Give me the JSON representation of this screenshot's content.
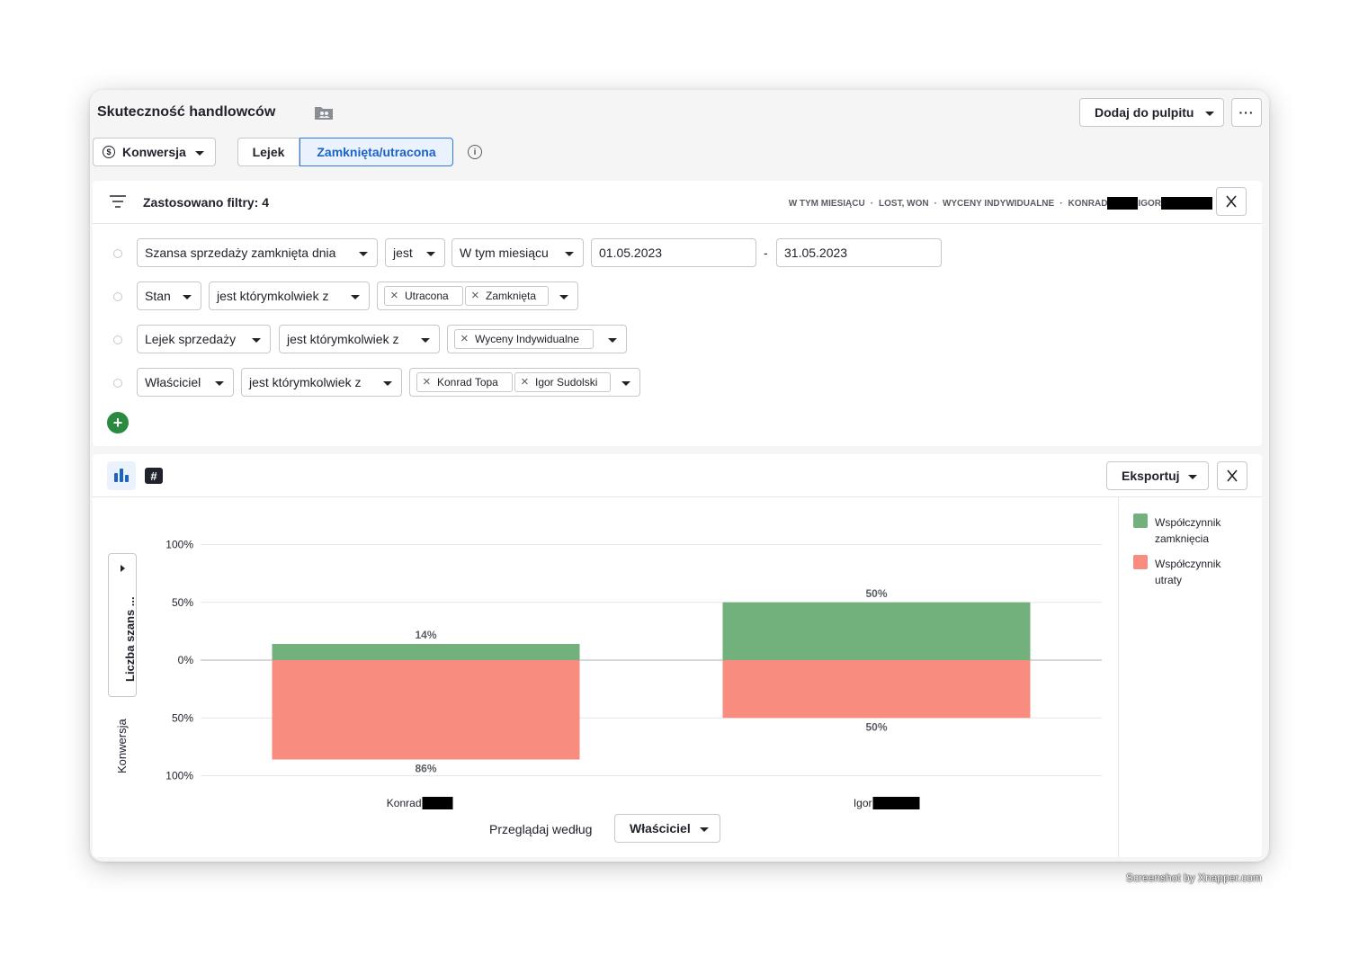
{
  "header": {
    "title": "Skuteczność handlowców",
    "add_to_dashboard": "Dodaj do pulpitu",
    "more": "···"
  },
  "controls": {
    "metric": "Konwersja",
    "seg_funnel": "Lejek",
    "seg_closed_lost": "Zamknięta/utracona",
    "info": "i"
  },
  "filters": {
    "title": "Zastosowano filtry: 4",
    "summary": [
      "W TYM MIESIĄCU",
      "LOST, WON",
      "WYCENY INDYWIDUALNE",
      "KONRAD",
      "IGOR"
    ],
    "rows": [
      {
        "field": "Szansa sprzedaży zamknięta dnia",
        "op": "jest",
        "period": "W tym miesiącu",
        "from": "01.05.2023",
        "sep": "-",
        "to": "31.05.2023"
      },
      {
        "field": "Stan",
        "op": "jest którymkolwiek z",
        "tags": [
          "Utracona",
          "Zamknięta"
        ]
      },
      {
        "field": "Lejek sprzedaży",
        "op": "jest którymkolwiek z",
        "tags": [
          "Wyceny Indywidualne"
        ]
      },
      {
        "field": "Właściciel",
        "op": "jest którymkolwiek z",
        "tags": [
          "Konrad Topa",
          "Igor Sudolski"
        ]
      }
    ],
    "add": "+"
  },
  "chart_toolbar": {
    "export": "Eksportuj",
    "table_view": "#"
  },
  "y_axis": {
    "selector_label": "Liczba szans ...",
    "label": "Konwersja"
  },
  "group_by": {
    "label": "Przeglądaj według",
    "value": "Właściciel"
  },
  "colors": {
    "won": "#72b07c",
    "lost": "#f88c7e",
    "accent": "#1b63c6",
    "add": "#2a8a3f"
  },
  "chart_data": {
    "type": "bar",
    "stacked": "diverging",
    "categories": [
      "Konrad",
      "Igor"
    ],
    "yticks": [
      "100%",
      "50%",
      "0%",
      "50%",
      "100%"
    ],
    "ylim": [
      -100,
      100
    ],
    "series": [
      {
        "name": "Współczynnik zamknięcia",
        "values": [
          14,
          50
        ],
        "labels": [
          "14%",
          "50%"
        ],
        "color": "#72b07c",
        "direction": "up"
      },
      {
        "name": "Współczynnik utraty",
        "values": [
          86,
          50
        ],
        "labels": [
          "86%",
          "50%"
        ],
        "color": "#f88c7e",
        "direction": "down"
      }
    ],
    "grid": true,
    "legend_position": "right"
  },
  "watermark": "Screenshot by Xnapper.com"
}
